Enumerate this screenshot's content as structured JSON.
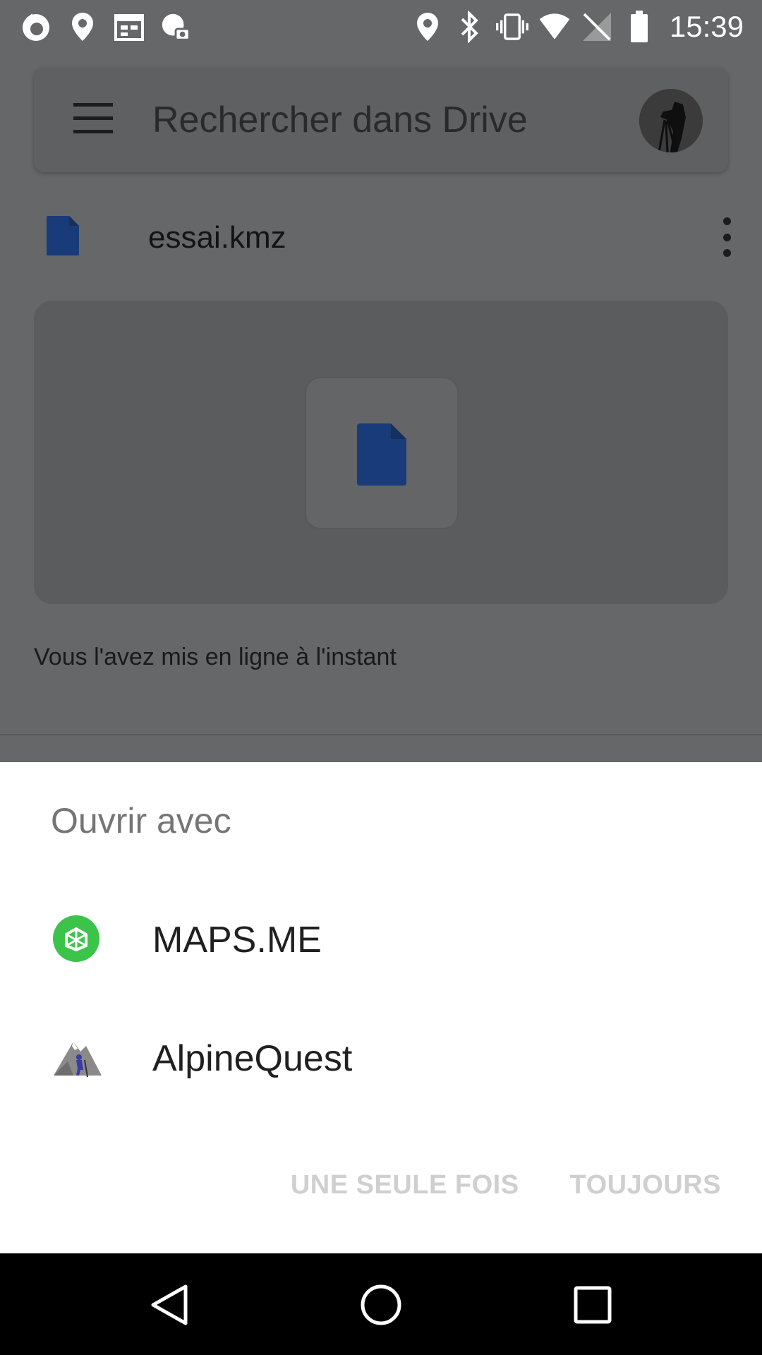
{
  "status_bar": {
    "time": "15:39",
    "left_icons": [
      "firefox-icon",
      "location-icon",
      "calendar-icon",
      "weather-icon"
    ],
    "right_icons": [
      "location-icon",
      "bluetooth-icon",
      "vibrate-icon",
      "wifi-icon",
      "no-signal-icon",
      "battery-icon"
    ]
  },
  "drive": {
    "search_placeholder": "Rechercher dans Drive",
    "file_name": "essai.kmz",
    "upload_note": "Vous l'avez mis en ligne à l'instant",
    "file_icon_color": "#1a3b7a"
  },
  "sheet": {
    "title": "Ouvrir avec",
    "apps": [
      {
        "label": "MAPS.ME",
        "icon": "mapsme-icon",
        "color": "#3cc34a"
      },
      {
        "label": "AlpineQuest",
        "icon": "alpinequest-icon"
      }
    ],
    "buttons": {
      "once": "UNE SEULE FOIS",
      "always": "TOUJOURS"
    }
  },
  "nav_bar": {
    "buttons": [
      "back-icon",
      "home-icon",
      "recents-icon"
    ]
  }
}
